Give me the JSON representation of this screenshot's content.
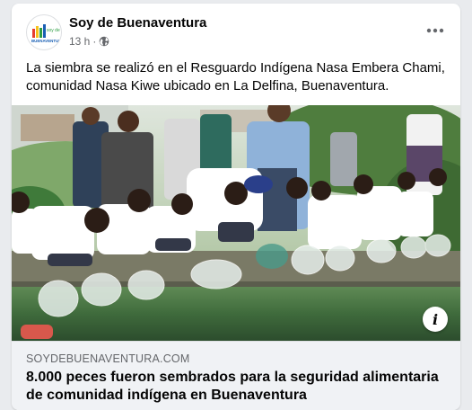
{
  "post": {
    "page_name": "Soy de Buenaventura",
    "time": "13 h",
    "separator": "·",
    "privacy_icon": "globe-icon",
    "more_icon": "more-horizontal-icon",
    "text": "La siembra se realizó en el Resguardo Indígena Nasa Embera Chami, comunidad Nasa Kiwe ubicado en La Delfina, Buenaventura."
  },
  "link_preview": {
    "domain": "SOYDEBUENAVENTURA.COM",
    "title": "8.000 peces fueron sembrados para la seguridad alimentaria de comunidad indígena en Buenaventura",
    "info_icon": "info-icon",
    "info_label": "i"
  },
  "avatar": {
    "logo_text": "soy de BUENAVENTURA",
    "colors": [
      "#e63c2f",
      "#1a5fb4",
      "#f6c21c",
      "#2e9e44"
    ]
  }
}
